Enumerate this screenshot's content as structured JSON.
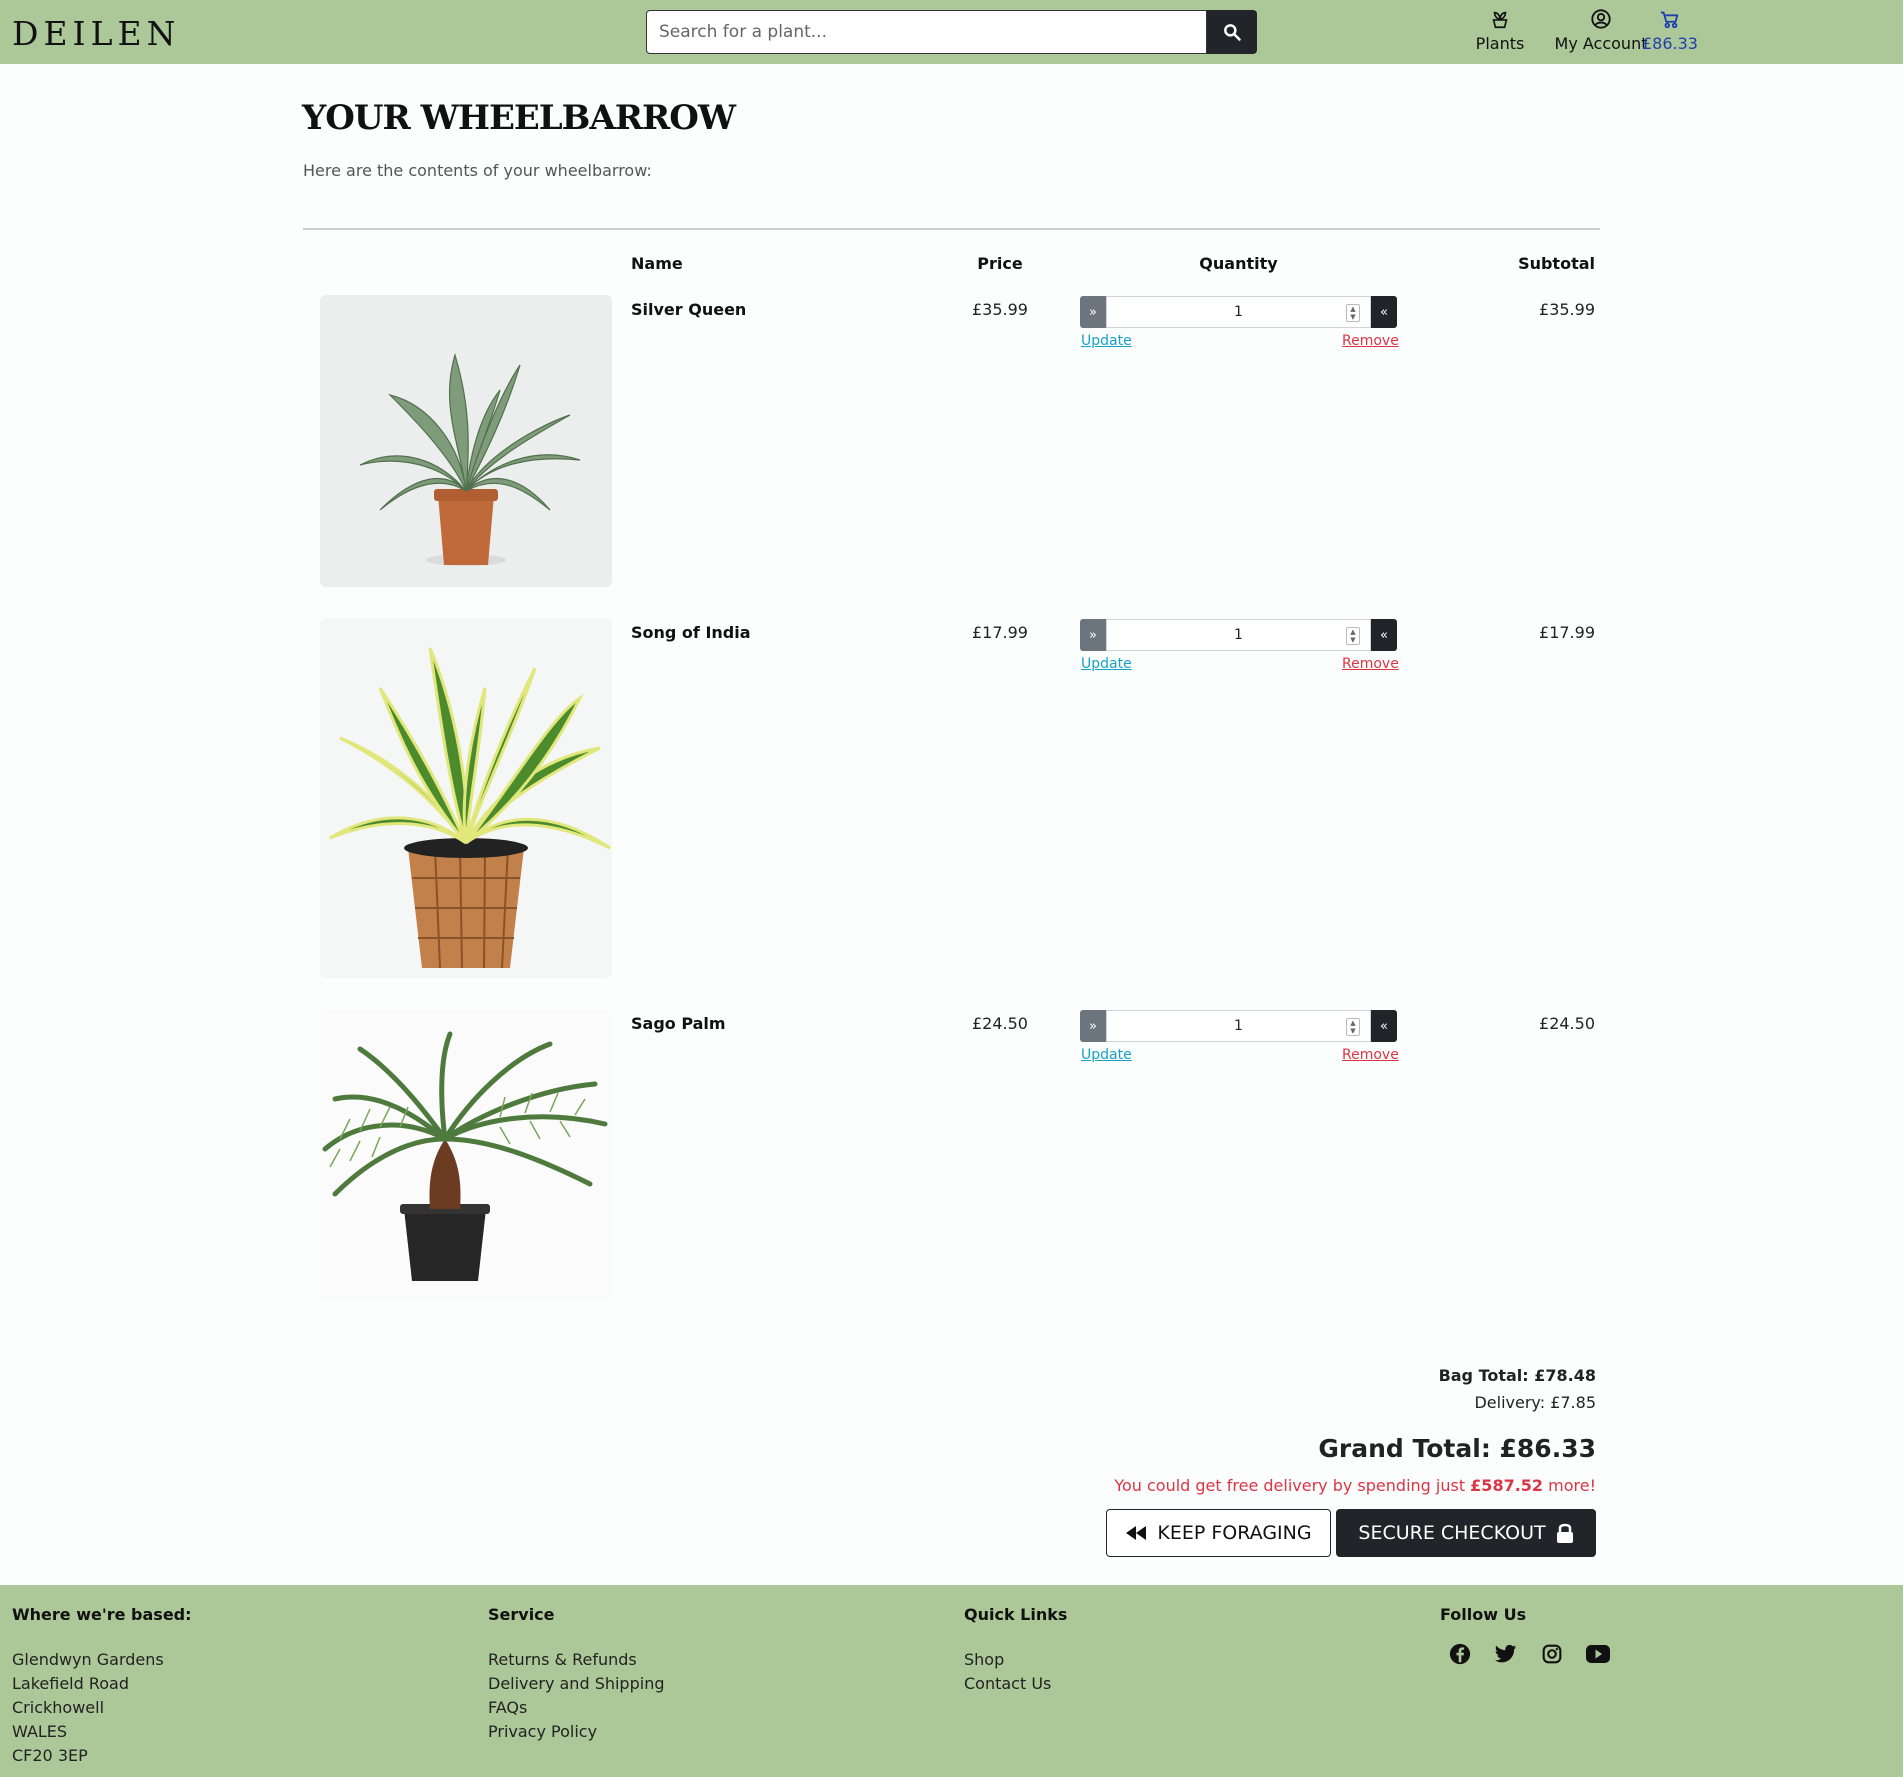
{
  "header": {
    "logo": "DEILEN",
    "search_placeholder": "Search for a plant...",
    "nav": {
      "plants": "Plants",
      "account": "My Account",
      "cart_total": "£86.33"
    }
  },
  "page": {
    "title": "YOUR WHEELBARROW",
    "intro": "Here are the contents of your wheelbarrow:"
  },
  "table": {
    "headers": {
      "name": "Name",
      "price": "Price",
      "quantity": "Quantity",
      "subtotal": "Subtotal"
    },
    "update_label": "Update",
    "remove_label": "Remove",
    "items": [
      {
        "name": "Silver Queen",
        "price": "£35.99",
        "quantity": "1",
        "subtotal": "£35.99"
      },
      {
        "name": "Song of India",
        "price": "£17.99",
        "quantity": "1",
        "subtotal": "£17.99"
      },
      {
        "name": "Sago Palm",
        "price": "£24.50",
        "quantity": "1",
        "subtotal": "£24.50"
      }
    ]
  },
  "totals": {
    "bag_total": "Bag Total: £78.48",
    "delivery": "Delivery: £7.85",
    "grand_total": "Grand Total: £86.33",
    "free_delivery_prefix": "You could get free delivery by spending just ",
    "free_delivery_amount": "£587.52",
    "free_delivery_suffix": " more!"
  },
  "buttons": {
    "keep_foraging": "KEEP FORAGING",
    "checkout": "SECURE CHECKOUT"
  },
  "footer": {
    "based": {
      "heading": "Where we're based:",
      "lines": [
        "Glendwyn Gardens",
        "Lakefield Road",
        "Crickhowell",
        "WALES",
        "CF20 3EP"
      ]
    },
    "service": {
      "heading": "Service",
      "links": [
        "Returns & Refunds",
        "Delivery and Shipping",
        "FAQs",
        "Privacy Policy"
      ]
    },
    "quick": {
      "heading": "Quick Links",
      "links": [
        "Shop",
        "Contact Us"
      ]
    },
    "follow": {
      "heading": "Follow Us",
      "icons": [
        "facebook-icon",
        "twitter-icon",
        "instagram-icon",
        "youtube-icon"
      ]
    }
  },
  "colors": {
    "header_bg": "#adc898",
    "cart_accent": "#1f3fae",
    "update_link": "#17a2c8",
    "remove_link": "#dc3545",
    "dark_button": "#212529"
  }
}
